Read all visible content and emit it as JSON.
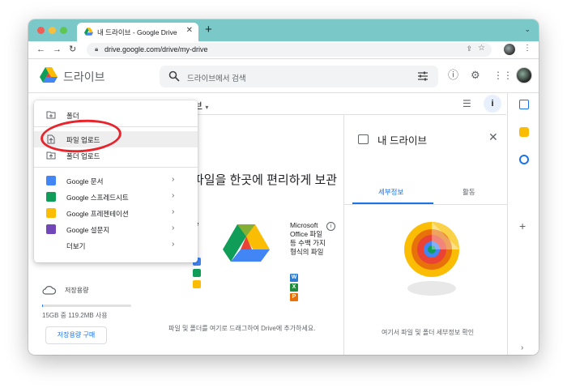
{
  "browser": {
    "tab_title": "내 드라이브 - Google Drive",
    "url": "drive.google.com/drive/my-drive"
  },
  "header": {
    "app_name": "드라이브",
    "search_placeholder": "드라이브에서 검색"
  },
  "breadcrumb": {
    "suffix": "브"
  },
  "new_menu": {
    "items": [
      {
        "label": "폴더"
      },
      {
        "label": "파일 업로드"
      },
      {
        "label": "폴더 업로드"
      },
      {
        "label": "Google 문서"
      },
      {
        "label": "Google 스프레드시트"
      },
      {
        "label": "Google 프레젠테이션"
      },
      {
        "label": "Google 설문지"
      },
      {
        "label": "더보기"
      }
    ]
  },
  "storage": {
    "label": "저장용량",
    "usage": "15GB 중 119.2MB 사용",
    "used_fraction": 0.008,
    "buy_button": "저장용량 구매"
  },
  "empty_state": {
    "title": "파일을 한곳에 편리하게 보관",
    "left_fragment": "e",
    "ms_text": "Microsoft Office 파일 등 수백 가지 형식의 파일",
    "subtitle": "파일 및 폴더를 여기로 드래그하여 Drive에 추가하세요."
  },
  "details": {
    "title": "내 드라이브",
    "tabs": [
      {
        "label": "세부정보",
        "active": true
      },
      {
        "label": "활동",
        "active": false
      }
    ],
    "caption": "여기서 파일 및 폴더 세부정보 확인"
  },
  "colors": {
    "tab_strip": "#7bc8c9",
    "accent": "#1a73e8",
    "highlight_circle": "#e8252c"
  }
}
